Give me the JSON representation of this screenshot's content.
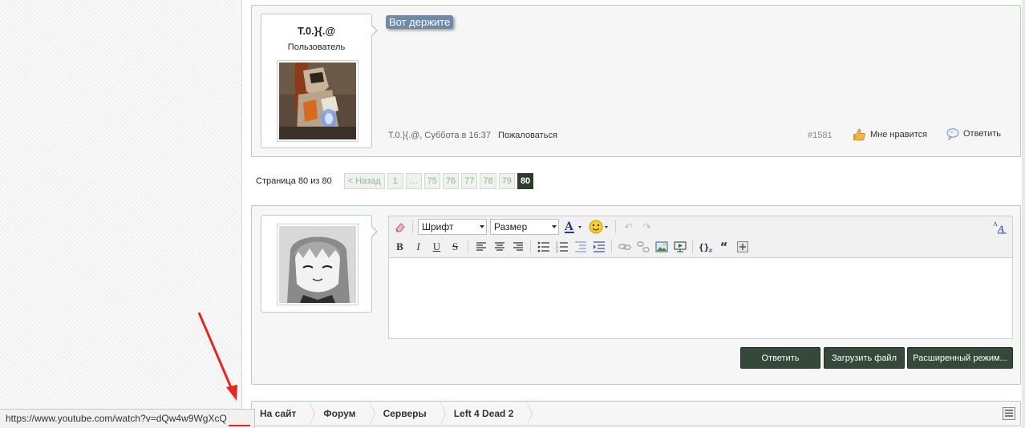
{
  "post": {
    "username": "T.0.}{.@",
    "user_title": "Пользователь",
    "message": "Вот держите",
    "meta_author_time": "T.0.}{.@, Суббота в 16:37",
    "report_label": "Пожаловаться",
    "post_number": "#1581",
    "like_label": "Мне нравится",
    "quote_label": "Ответить"
  },
  "pagination": {
    "label": "Страница 80 из 80",
    "prev_label": "< Назад",
    "pages": [
      "1",
      "…",
      "75",
      "76",
      "77",
      "78",
      "79",
      "80"
    ],
    "current": "80"
  },
  "editor": {
    "font_select": "Шрифт",
    "size_select": "Размер",
    "buttons": {
      "bold": "B",
      "italic": "I",
      "underline": "U",
      "strike": "S",
      "quote": "“"
    },
    "source_toggle": "A"
  },
  "reply_buttons": {
    "reply": "Ответить",
    "upload": "Загрузить файл",
    "advanced": "Расширенный режим..."
  },
  "breadcrumb": [
    "На сайт",
    "Форум",
    "Серверы",
    "Left 4 Dead 2"
  ],
  "status_url": "https://www.youtube.com/watch?v=dQw4w9WgXcQ",
  "colors": {
    "accent_dark": "#34493a",
    "panel_border": "#b8cdb8",
    "message_highlight": "#6e8aa6",
    "annotation_red": "#e5271e"
  }
}
